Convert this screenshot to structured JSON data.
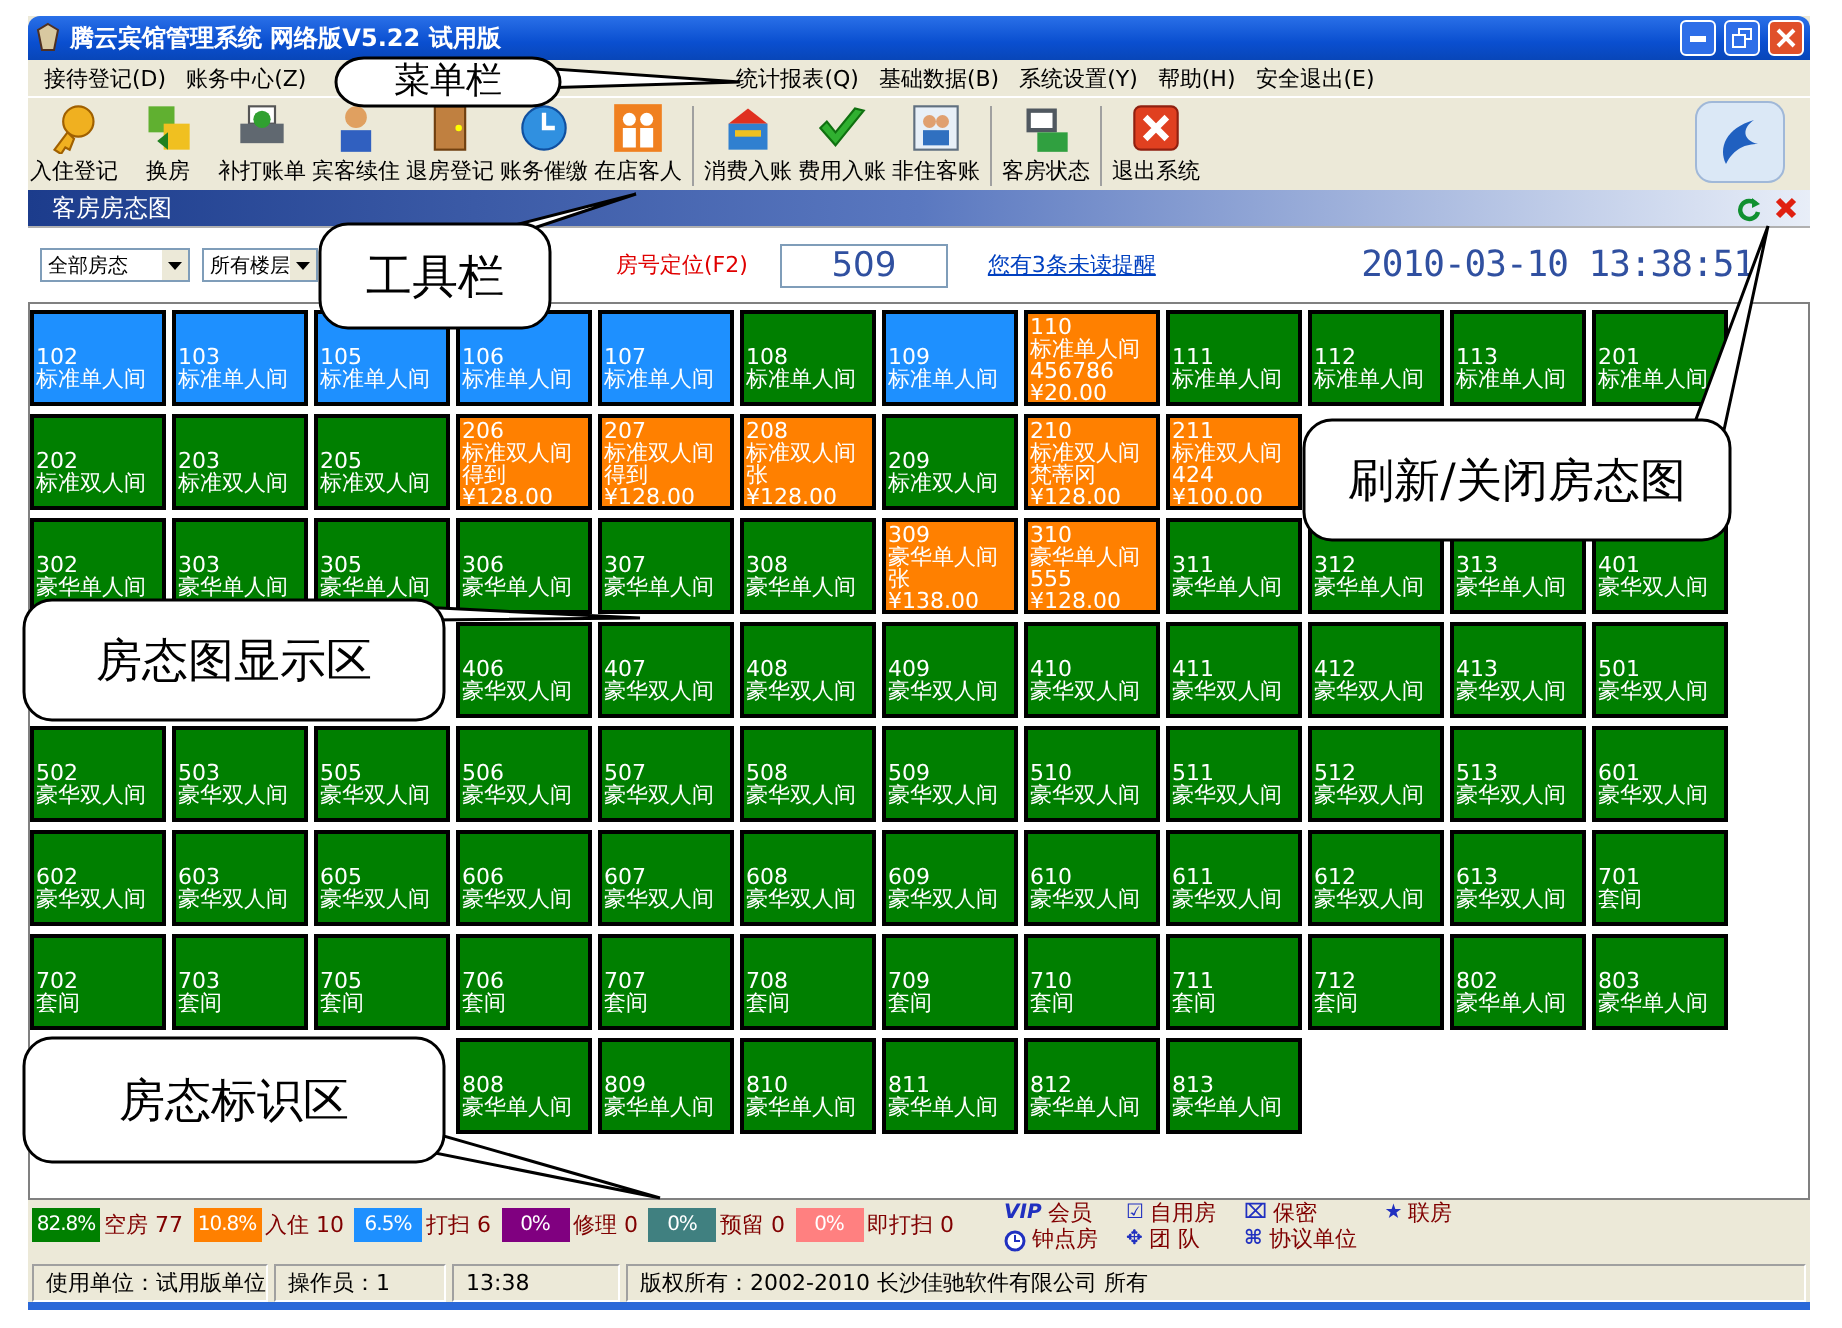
{
  "window": {
    "title": "腾云宾馆管理系统 网络版V5.22 试用版"
  },
  "menu": [
    "接待登记(D)",
    "账务中心(Z)",
    "统计报表(Q)",
    "基础数据(B)",
    "系统设置(Y)",
    "帮助(H)",
    "安全退出(E)"
  ],
  "toolbar": [
    "入住登记",
    "换房",
    "补打账单",
    "宾客续住",
    "退房登记",
    "账务催缴",
    "在店客人",
    "消费入账",
    "费用入账",
    "非住客账",
    "客房状态",
    "退出系统"
  ],
  "panel": {
    "title": "客房房态图"
  },
  "filters": {
    "status_select": "全部房态",
    "floor_select": "所有楼层",
    "locate_label": "房号定位(F2)",
    "room_no": "509",
    "reminder_link": "您有3条未读提醒",
    "datetime": "2010-03-10 13:38:51"
  },
  "room_rows": [
    [
      {
        "number": "102",
        "type": "标准单人间",
        "color": "#1e90ff"
      },
      {
        "number": "103",
        "type": "标准单人间",
        "color": "#1e90ff"
      },
      {
        "number": "105",
        "type": "标准单人间",
        "color": "#1e90ff"
      },
      {
        "number": "106",
        "type": "标准单人间",
        "color": "#1e90ff"
      },
      {
        "number": "107",
        "type": "标准单人间",
        "color": "#1e90ff"
      },
      {
        "number": "108",
        "type": "标准单人间",
        "color": "#007f00"
      },
      {
        "number": "109",
        "type": "标准单人间",
        "color": "#1e90ff"
      },
      {
        "number": "110",
        "type": "标准单人间",
        "color": "#ff8000",
        "guest": "456786",
        "price": "¥20.00"
      },
      {
        "number": "111",
        "type": "标准单人间",
        "color": "#007f00"
      },
      {
        "number": "112",
        "type": "标准单人间",
        "color": "#007f00"
      },
      {
        "number": "113",
        "type": "标准单人间",
        "color": "#007f00"
      },
      {
        "number": "201",
        "type": "标准单人间",
        "color": "#007f00"
      }
    ],
    [
      {
        "number": "202",
        "type": "标准双人间",
        "color": "#007f00"
      },
      {
        "number": "203",
        "type": "标准双人间",
        "color": "#007f00"
      },
      {
        "number": "205",
        "type": "标准双人间",
        "color": "#007f00"
      },
      {
        "number": "206",
        "type": "标准双人间",
        "color": "#ff8000",
        "guest": "得到",
        "price": "¥128.00"
      },
      {
        "number": "207",
        "type": "标准双人间",
        "color": "#ff8000",
        "guest": "得到",
        "price": "¥128.00"
      },
      {
        "number": "208",
        "type": "标准双人间",
        "color": "#ff8000",
        "guest": "张",
        "price": "¥128.00"
      },
      {
        "number": "209",
        "type": "标准双人间",
        "color": "#007f00"
      },
      {
        "number": "210",
        "type": "标准双人间",
        "color": "#ff8000",
        "guest": "梵蒂冈",
        "price": "¥128.00"
      },
      {
        "number": "211",
        "type": "标准双人间",
        "color": "#ff8000",
        "guest": "424",
        "price": "¥100.00"
      }
    ],
    [
      {
        "number": "302",
        "type": "豪华单人间",
        "color": "#007f00"
      },
      {
        "number": "303",
        "type": "豪华单人间",
        "color": "#007f00"
      },
      {
        "number": "305",
        "type": "豪华单人间",
        "color": "#007f00"
      },
      {
        "number": "306",
        "type": "豪华单人间",
        "color": "#007f00"
      },
      {
        "number": "307",
        "type": "豪华单人间",
        "color": "#007f00"
      },
      {
        "number": "308",
        "type": "豪华单人间",
        "color": "#007f00"
      },
      {
        "number": "309",
        "type": "豪华单人间",
        "color": "#ff8000",
        "guest": "张",
        "price": "¥138.00"
      },
      {
        "number": "310",
        "type": "豪华单人间",
        "color": "#ff8000",
        "guest": "555",
        "price": "¥128.00"
      },
      {
        "number": "311",
        "type": "豪华单人间",
        "color": "#007f00"
      },
      {
        "number": "312",
        "type": "豪华单人间",
        "color": "#007f00"
      },
      {
        "number": "313",
        "type": "豪华单人间",
        "color": "#007f00"
      },
      {
        "number": "401",
        "type": "豪华双人间",
        "color": "#007f00"
      }
    ],
    [
      {
        "number": "406",
        "type": "豪华双人间",
        "color": "#007f00"
      },
      {
        "number": "407",
        "type": "豪华双人间",
        "color": "#007f00"
      },
      {
        "number": "408",
        "type": "豪华双人间",
        "color": "#007f00"
      },
      {
        "number": "409",
        "type": "豪华双人间",
        "color": "#007f00"
      },
      {
        "number": "410",
        "type": "豪华双人间",
        "color": "#007f00"
      },
      {
        "number": "411",
        "type": "豪华双人间",
        "color": "#007f00"
      },
      {
        "number": "412",
        "type": "豪华双人间",
        "color": "#007f00"
      },
      {
        "number": "413",
        "type": "豪华双人间",
        "color": "#007f00"
      },
      {
        "number": "501",
        "type": "豪华双人间",
        "color": "#007f00"
      }
    ],
    [
      {
        "number": "502",
        "type": "豪华双人间",
        "color": "#007f00"
      },
      {
        "number": "503",
        "type": "豪华双人间",
        "color": "#007f00"
      },
      {
        "number": "505",
        "type": "豪华双人间",
        "color": "#007f00"
      },
      {
        "number": "506",
        "type": "豪华双人间",
        "color": "#007f00"
      },
      {
        "number": "507",
        "type": "豪华双人间",
        "color": "#007f00"
      },
      {
        "number": "508",
        "type": "豪华双人间",
        "color": "#007f00"
      },
      {
        "number": "509",
        "type": "豪华双人间",
        "color": "#007f00"
      },
      {
        "number": "510",
        "type": "豪华双人间",
        "color": "#007f00"
      },
      {
        "number": "511",
        "type": "豪华双人间",
        "color": "#007f00"
      },
      {
        "number": "512",
        "type": "豪华双人间",
        "color": "#007f00"
      },
      {
        "number": "513",
        "type": "豪华双人间",
        "color": "#007f00"
      },
      {
        "number": "601",
        "type": "豪华双人间",
        "color": "#007f00"
      }
    ],
    [
      {
        "number": "602",
        "type": "豪华双人间",
        "color": "#007f00"
      },
      {
        "number": "603",
        "type": "豪华双人间",
        "color": "#007f00"
      },
      {
        "number": "605",
        "type": "豪华双人间",
        "color": "#007f00"
      },
      {
        "number": "606",
        "type": "豪华双人间",
        "color": "#007f00"
      },
      {
        "number": "607",
        "type": "豪华双人间",
        "color": "#007f00"
      },
      {
        "number": "608",
        "type": "豪华双人间",
        "color": "#007f00"
      },
      {
        "number": "609",
        "type": "豪华双人间",
        "color": "#007f00"
      },
      {
        "number": "610",
        "type": "豪华双人间",
        "color": "#007f00"
      },
      {
        "number": "611",
        "type": "豪华双人间",
        "color": "#007f00"
      },
      {
        "number": "612",
        "type": "豪华双人间",
        "color": "#007f00"
      },
      {
        "number": "613",
        "type": "豪华双人间",
        "color": "#007f00"
      },
      {
        "number": "701",
        "type": "套间",
        "color": "#007f00"
      }
    ],
    [
      {
        "number": "702",
        "type": "套间",
        "color": "#007f00"
      },
      {
        "number": "703",
        "type": "套间",
        "color": "#007f00"
      },
      {
        "number": "705",
        "type": "套间",
        "color": "#007f00"
      },
      {
        "number": "706",
        "type": "套间",
        "color": "#007f00"
      },
      {
        "number": "707",
        "type": "套间",
        "color": "#007f00"
      },
      {
        "number": "708",
        "type": "套间",
        "color": "#007f00"
      },
      {
        "number": "709",
        "type": "套间",
        "color": "#007f00"
      },
      {
        "number": "710",
        "type": "套间",
        "color": "#007f00"
      },
      {
        "number": "711",
        "type": "套间",
        "color": "#007f00"
      },
      {
        "number": "712",
        "type": "套间",
        "color": "#007f00"
      },
      {
        "number": "802",
        "type": "豪华单人间",
        "color": "#007f00"
      },
      {
        "number": "803",
        "type": "豪华单人间",
        "color": "#007f00"
      }
    ],
    [
      {
        "number": "808",
        "type": "豪华单人间",
        "color": "#007f00"
      },
      {
        "number": "809",
        "type": "豪华单人间",
        "color": "#007f00"
      },
      {
        "number": "810",
        "type": "豪华单人间",
        "color": "#007f00"
      },
      {
        "number": "811",
        "type": "豪华单人间",
        "color": "#007f00"
      },
      {
        "number": "812",
        "type": "豪华单人间",
        "color": "#007f00"
      },
      {
        "number": "813",
        "type": "豪华单人间",
        "color": "#007f00"
      }
    ]
  ],
  "legend": [
    {
      "percent": "82.8%",
      "label": "空房 77",
      "color": "#008000"
    },
    {
      "percent": "10.8%",
      "label": "入住 10",
      "color": "#ff8000"
    },
    {
      "percent": "6.5%",
      "label": "打扫 6",
      "color": "#1e90ff"
    },
    {
      "percent": "0%",
      "label": "修理 0",
      "color": "#800080"
    },
    {
      "percent": "0%",
      "label": "预留 0",
      "color": "#408080"
    },
    {
      "percent": "0%",
      "label": "即打扫 0",
      "color": "#ff8080"
    }
  ],
  "marks": [
    {
      "kind": "text",
      "symbol": "VIP",
      "label": "会员"
    },
    {
      "kind": "clock",
      "label": "钟点房"
    },
    {
      "kind": "text",
      "symbol": "☑",
      "label": "自用房"
    },
    {
      "kind": "text",
      "symbol": "✥",
      "label": "团 队"
    },
    {
      "kind": "text",
      "symbol": "⌧",
      "label": "保密"
    },
    {
      "kind": "text",
      "symbol": "⌘",
      "label": "协议单位"
    },
    {
      "kind": "text",
      "symbol": "★",
      "label": "联房"
    }
  ],
  "status_bar": [
    "使用单位：试用版单位",
    "操作员：1",
    "13:38",
    "版权所有：2002-2010 长沙佳驰软件有限公司 所有"
  ],
  "callouts": [
    {
      "text": "菜单栏"
    },
    {
      "text": "工具栏"
    },
    {
      "text": "刷新/关闭房态图"
    },
    {
      "text": "房态图显示区"
    },
    {
      "text": "房态标识区"
    }
  ]
}
